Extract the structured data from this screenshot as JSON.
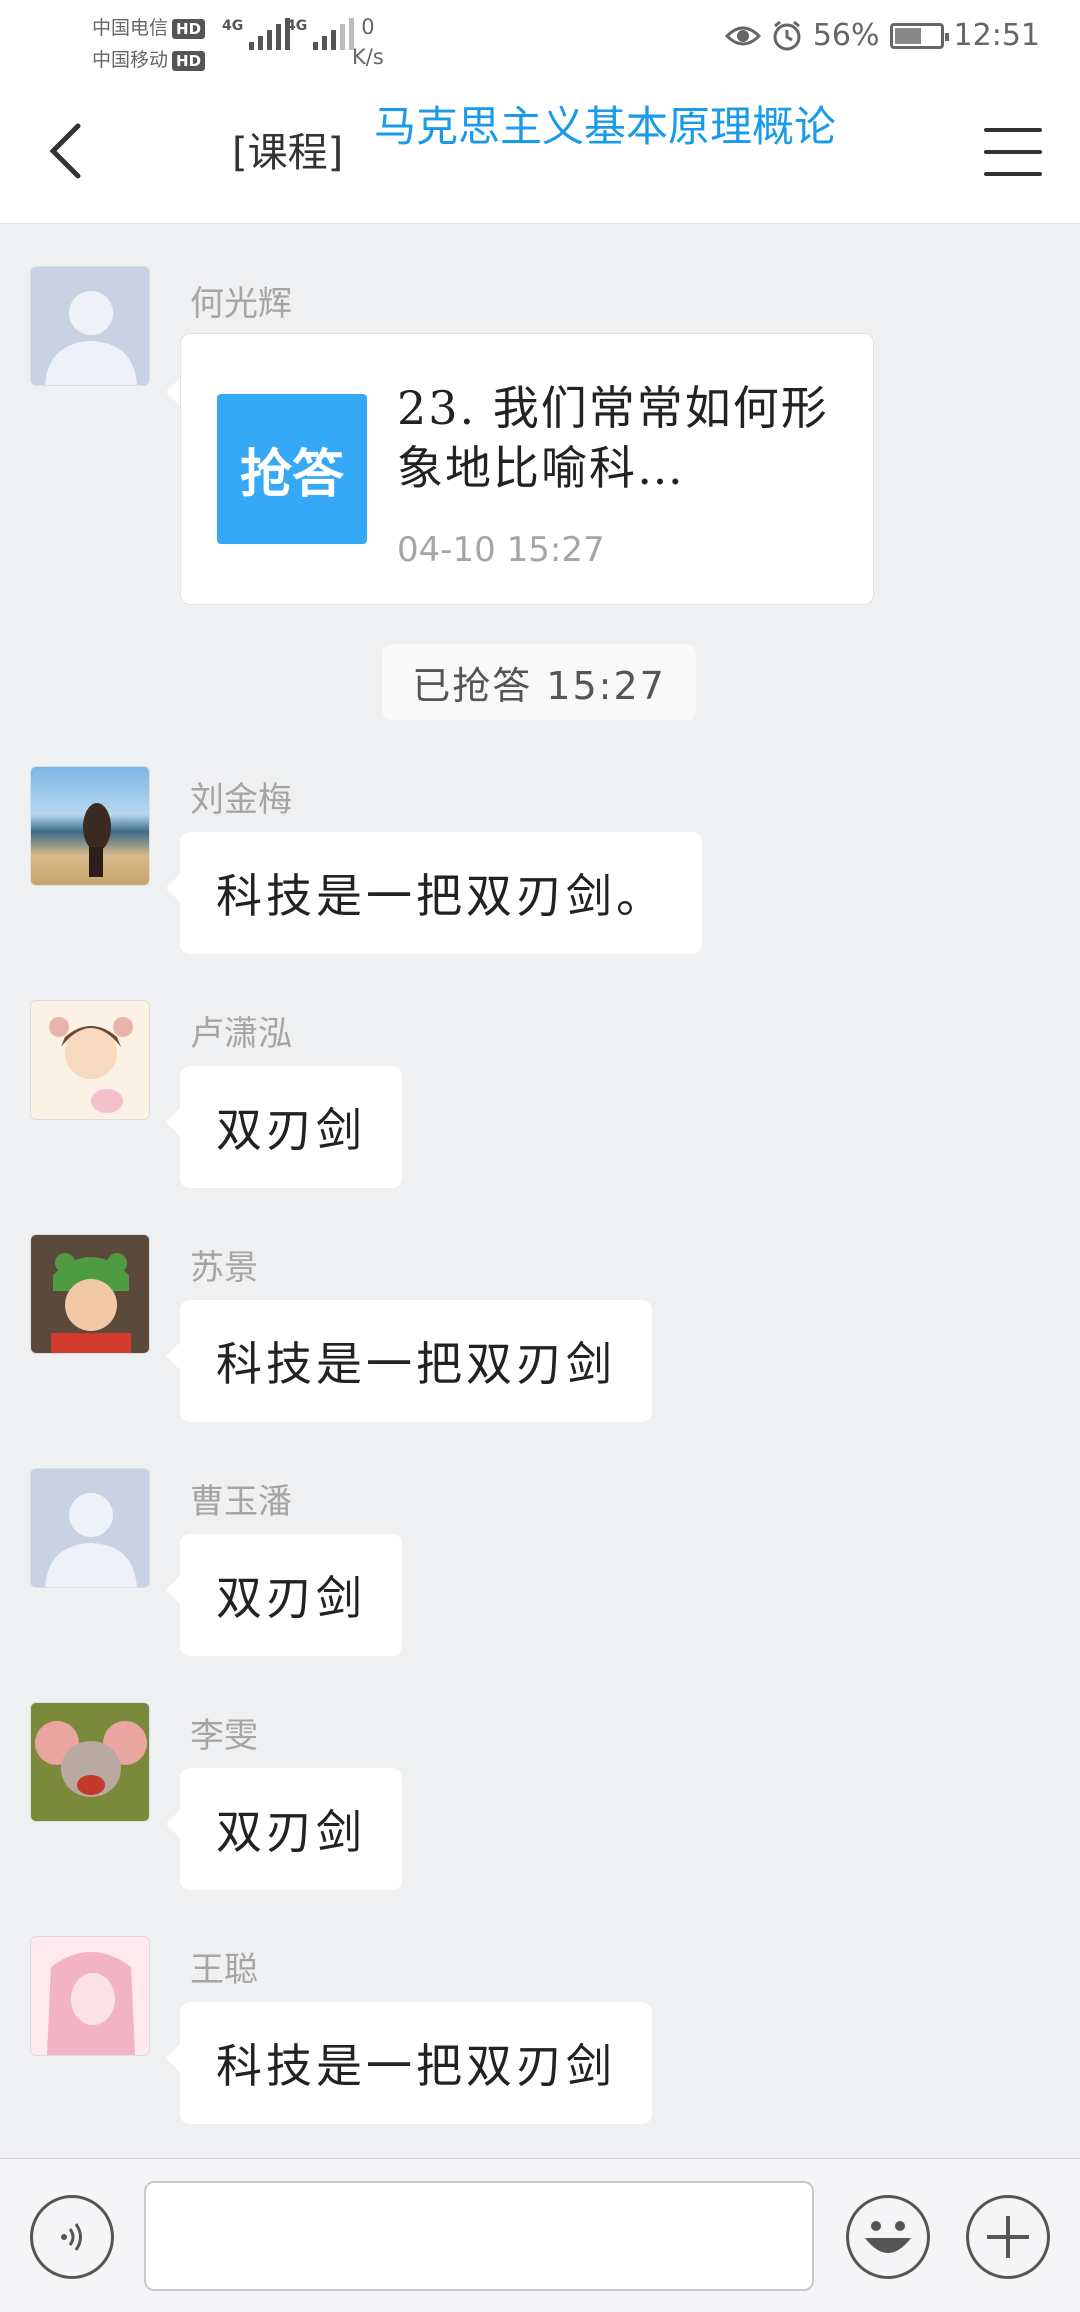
{
  "status_bar": {
    "carrier_1": "中国电信",
    "carrier_2": "中国移动",
    "hd_label": "HD",
    "network_1": "4G",
    "network_2": "4G",
    "net_speed_value": "0",
    "net_speed_unit": "K/s",
    "battery": "56%",
    "battery_level": 0.56,
    "time": "12:51",
    "icons": [
      "eye-icon",
      "alarm-icon",
      "battery-icon"
    ]
  },
  "header": {
    "tag": "[课程]",
    "title": "马克思主义基本原理概论",
    "icons": [
      "back-arrow-icon",
      "menu-icon"
    ]
  },
  "question": {
    "sender": "何光辉",
    "badge": "抢答",
    "text": "23. 我们常常如何形象地比喻科…",
    "time": "04-10 15:27"
  },
  "system_note": "已抢答 15:27",
  "messages": [
    {
      "sender": "刘金梅",
      "text": "科技是一把双刃剑。"
    },
    {
      "sender": "卢潇泓",
      "text": "双刃剑"
    },
    {
      "sender": "苏景",
      "text": "科技是一把双刃剑"
    },
    {
      "sender": "曹玉潘",
      "text": "双刃剑"
    },
    {
      "sender": "李雯",
      "text": "双刃剑"
    },
    {
      "sender": "王聪",
      "text": "科技是一把双刃剑"
    }
  ],
  "input_bar": {
    "placeholder": "",
    "icons": [
      "voice-icon",
      "emoji-icon",
      "plus-icon"
    ]
  },
  "colors": {
    "accent": "#1a9be8",
    "badge": "#35a9f5",
    "background": "#eff0f2"
  }
}
